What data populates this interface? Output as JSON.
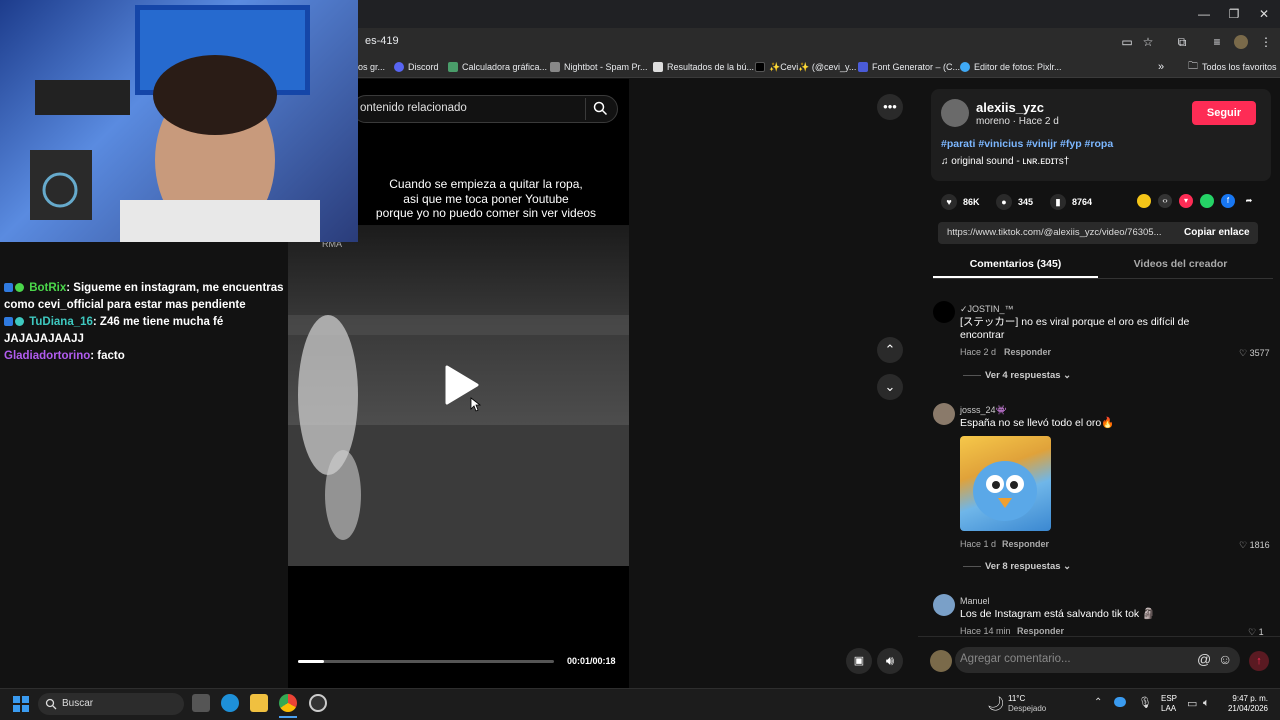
{
  "browser": {
    "address_suffix": "es-419",
    "bookmarks": [
      {
        "label": "os gr..."
      },
      {
        "label": "Discord"
      },
      {
        "label": "Calculadora gráfica..."
      },
      {
        "label": "Nightbot - Spam Pr..."
      },
      {
        "label": "Resultados de la bú..."
      },
      {
        "label": "✨Cevi✨ (@cevi_y..."
      },
      {
        "label": "Font Generator – (C..."
      },
      {
        "label": "Editor de fotos: Pixlr..."
      }
    ],
    "bookmarks_more": "»",
    "all_bookmarks": "Todos los favoritos"
  },
  "chat": [
    {
      "user": "BotRix",
      "message": ": Sigueme en instagram, me encuentras como cevi_official para estar mas pendiente"
    },
    {
      "user": "TuDiana_16",
      "message": ": Z46 me tiene mucha fé JAJAJAJAAJJ"
    },
    {
      "user": "Gladiadortorino",
      "message": ": facto"
    }
  ],
  "search": {
    "placeholder": "ontenido relacionado"
  },
  "video": {
    "caption_lines": [
      "Cuando se empieza a quitar la ropa,",
      "asi que me toca poner Youtube",
      "porque yo no puedo comer sin ver videos"
    ],
    "watermark": "RMA",
    "time": "00:01/00:18",
    "progress": 0.1
  },
  "creator": {
    "username": "alexiis_yzc",
    "subline": "moreno · Hace 2 d",
    "follow_label": "Seguir",
    "hashtags": "#parati #vinicius #vinijr #fyp #ropa",
    "sound": "original sound - ʟɴʀ.ᴇᴅɪᴛs†"
  },
  "stats": {
    "likes": "86K",
    "comments": "345",
    "saves": "8764"
  },
  "link": {
    "url": "https://www.tiktok.com/@alexiis_yzc/video/76305...",
    "copy_label": "Copiar enlace"
  },
  "tabs": {
    "comments": "Comentarios (345)",
    "creator_videos": "Videos del creador"
  },
  "comments": [
    {
      "user": "✓JOSTIN_™",
      "text": "[ステッカー] no es viral porque el oro es difícil de encontrar",
      "time": "Hace 2 d",
      "reply": "Responder",
      "likes": "3577",
      "more": "Ver 4 respuestas"
    },
    {
      "user": "josss_24👾",
      "text": "España no se llevó todo el oro🔥",
      "time": "Hace 1 d",
      "reply": "Responder",
      "likes": "1816",
      "more": "Ver 8 respuestas"
    },
    {
      "user": "Manuel",
      "text": "Los de Instagram está salvando tik tok 🗿",
      "time": "Hace 14 min",
      "reply": "Responder",
      "likes": "1"
    }
  ],
  "comment_input": {
    "placeholder": "Agregar comentario..."
  },
  "taskbar": {
    "search_label": "Buscar",
    "weather_temp": "11°C",
    "weather_desc": "Despejado",
    "lang_top": "ESP",
    "lang_bottom": "LAA",
    "time": "9:47 p. m.",
    "date": "21/04/2026"
  },
  "colors": {
    "accent": "#fe2c55",
    "hashtag": "#7cb7ff"
  }
}
